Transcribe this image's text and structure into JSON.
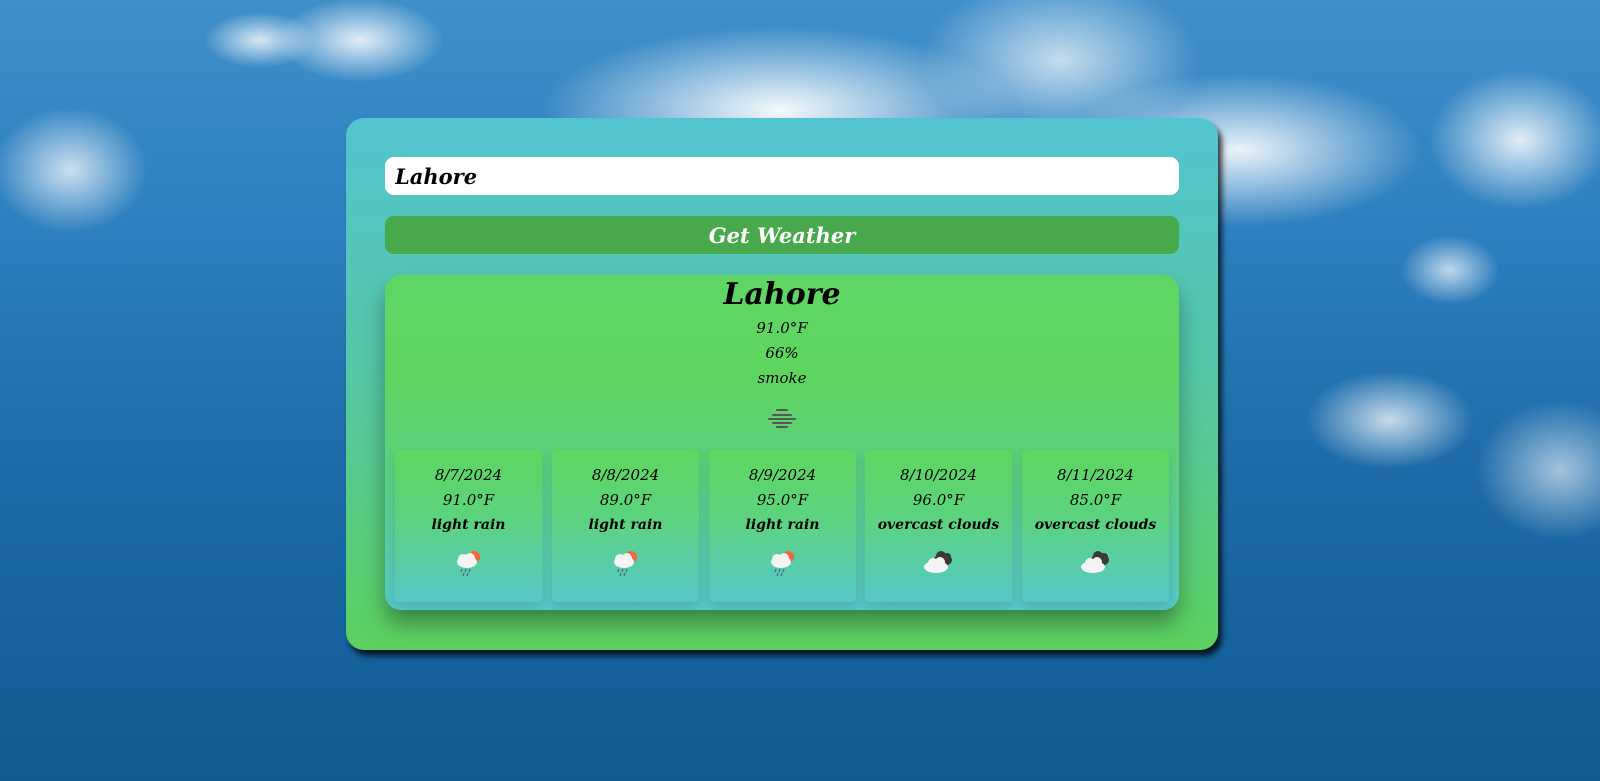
{
  "search": {
    "value": "Lahore",
    "button_label": "Get Weather"
  },
  "current": {
    "city": "Lahore",
    "temperature": "91.0°F",
    "humidity": "66%",
    "description": "smoke",
    "icon": "haze-icon"
  },
  "forecast": [
    {
      "date": "8/7/2024",
      "temperature": "91.0°F",
      "description": "light rain",
      "icon": "rain-sun-icon"
    },
    {
      "date": "8/8/2024",
      "temperature": "89.0°F",
      "description": "light rain",
      "icon": "rain-sun-icon"
    },
    {
      "date": "8/9/2024",
      "temperature": "95.0°F",
      "description": "light rain",
      "icon": "rain-sun-icon"
    },
    {
      "date": "8/10/2024",
      "temperature": "96.0°F",
      "description": "overcast clouds",
      "icon": "overcast-clouds-icon"
    },
    {
      "date": "8/11/2024",
      "temperature": "85.0°F",
      "description": "overcast clouds",
      "icon": "overcast-clouds-icon"
    }
  ],
  "colors": {
    "card_top": "#52c4d0",
    "card_bottom": "#5cd15f",
    "button": "#48a84c",
    "panel": "#5fd564"
  }
}
